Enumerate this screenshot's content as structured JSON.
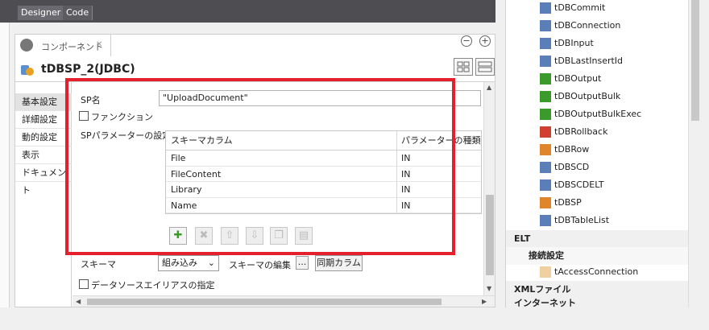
{
  "editor_tabs": [
    "Designer",
    "Code"
  ],
  "component_panel": {
    "tab_label": "コンポーネント",
    "title": "tDBSP_2(JDBC)"
  },
  "vertical_tabs": [
    "基本設定",
    "詳細設定",
    "動的設定",
    "表示",
    "ドキュメント"
  ],
  "form": {
    "sp_name_label": "SP名",
    "sp_name_value": "\"UploadDocument\"",
    "function_label": "ファンクション",
    "sp_params_label": "SPパラメーターの設定",
    "schema_label": "スキーマ",
    "schema_select": "組み込み",
    "schema_edit_label": "スキーマの編集",
    "schema_edit_button": "...",
    "sync_columns_button": "同期カラム",
    "datasource_alias_label": "データソースエイリアスの指定"
  },
  "param_table": {
    "columns": [
      "スキーマカラム",
      "パラメーターの種類"
    ],
    "rows": [
      [
        "File",
        "IN"
      ],
      [
        "FileContent",
        "IN"
      ],
      [
        "Library",
        "IN"
      ],
      [
        "Name",
        "IN"
      ]
    ]
  },
  "table_toolbar": [
    "add",
    "remove",
    "move-up",
    "move-down",
    "copy",
    "paste"
  ],
  "palette": {
    "items": [
      "tDBCommit",
      "tDBConnection",
      "tDBInput",
      "tDBLastInsertId",
      "tDBOutput",
      "tDBOutputBulk",
      "tDBOutputBulkExec",
      "tDBRollback",
      "tDBRow",
      "tDBSCD",
      "tDBSCDELT",
      "tDBSP",
      "tDBTableList"
    ],
    "category_elt": "ELT",
    "subcategory": "接続設定",
    "sub_item": "tAccessConnection",
    "category_xml": "XMLファイル",
    "category_internet": "インターネット"
  },
  "colors": {
    "highlight_box": "#e3202c",
    "add_icon": "#3a9a2a"
  }
}
